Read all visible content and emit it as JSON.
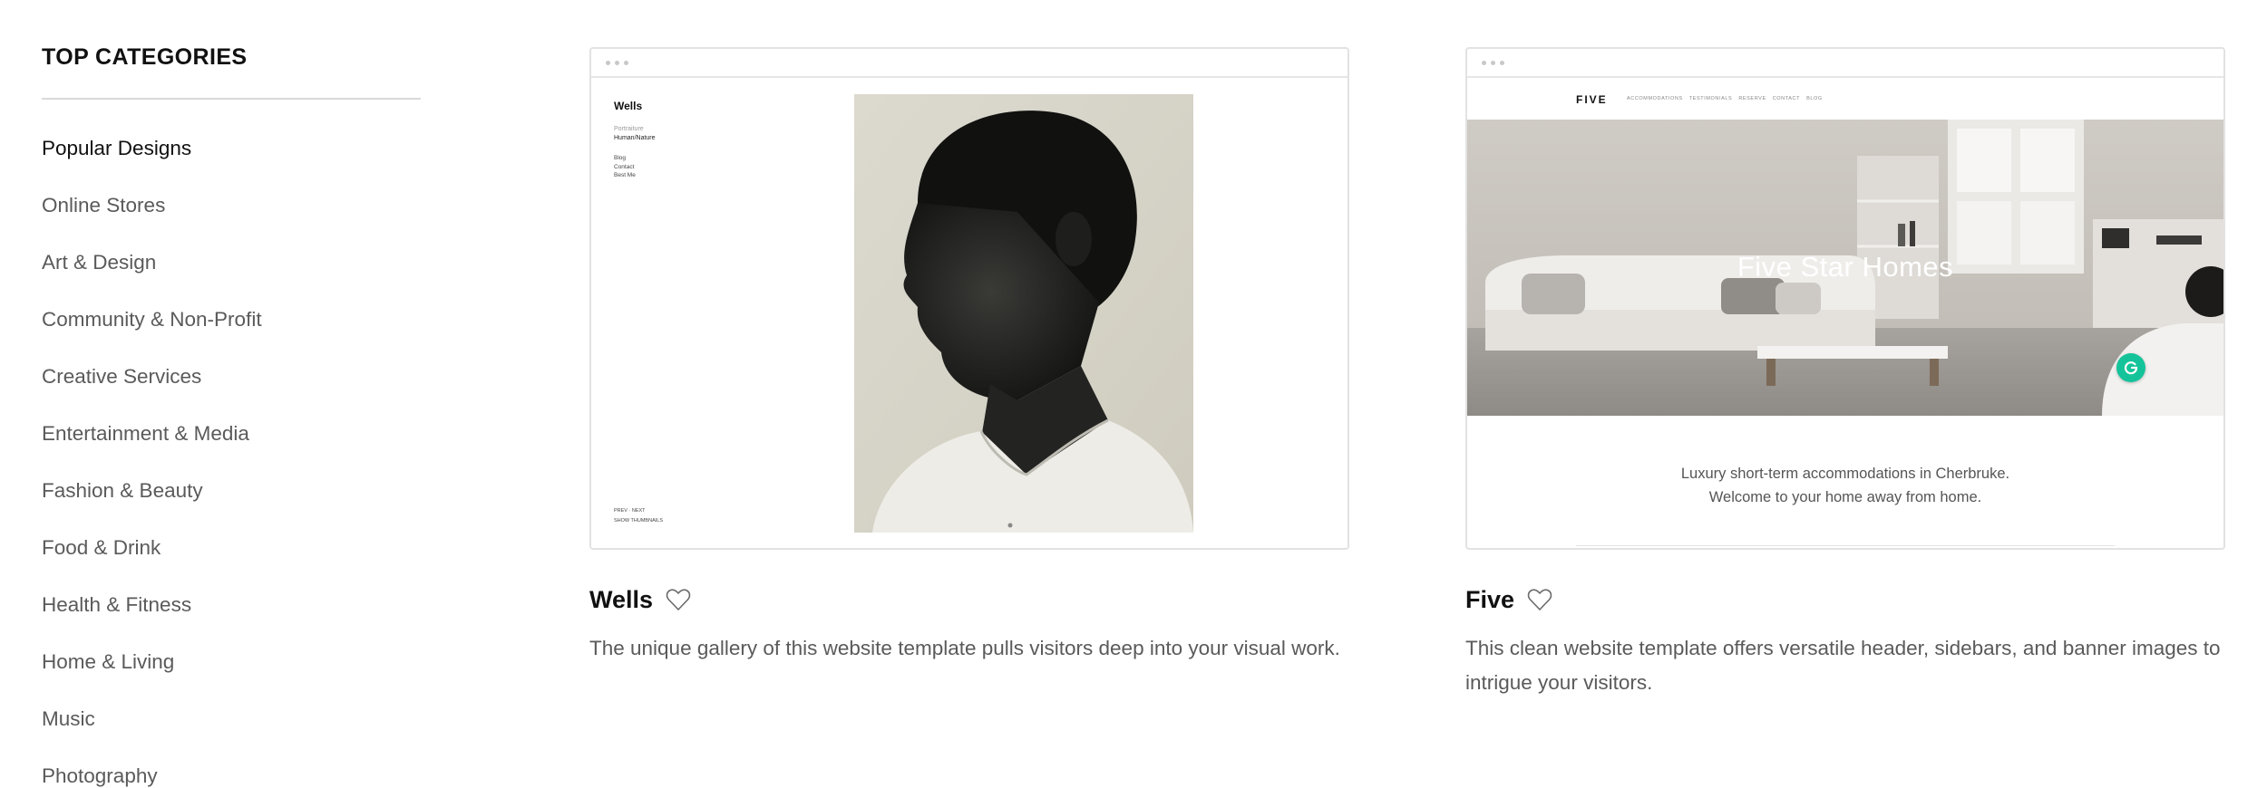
{
  "sidebar": {
    "heading": "TOP CATEGORIES",
    "categories": [
      {
        "label": "Popular Designs",
        "active": true
      },
      {
        "label": "Online Stores"
      },
      {
        "label": "Art & Design"
      },
      {
        "label": "Community & Non-Profit"
      },
      {
        "label": "Creative Services"
      },
      {
        "label": "Entertainment & Media"
      },
      {
        "label": "Fashion & Beauty"
      },
      {
        "label": "Food & Drink"
      },
      {
        "label": "Health & Fitness"
      },
      {
        "label": "Home & Living"
      },
      {
        "label": "Music"
      },
      {
        "label": "Photography"
      }
    ]
  },
  "templates": [
    {
      "name": "Wells",
      "description": "The unique gallery of this website template pulls visitors deep into your visual work.",
      "favorite_icon": "heart-outline-icon",
      "preview": {
        "site_title": "Wells",
        "nav": [
          "Portraiture",
          "Human/Nature"
        ],
        "nav_secondary": [
          "Blog",
          "Contact",
          "Best Me"
        ],
        "footer_nav": "PREV · NEXT",
        "footer_link": "SHOW THUMBNAILS"
      }
    },
    {
      "name": "Five",
      "description": "This clean website template offers versatile header, sidebars, and banner images to intrigue your visitors.",
      "favorite_icon": "heart-outline-icon",
      "preview": {
        "logo": "FIVE",
        "menu": [
          "ACCOMMODATIONS",
          "TESTIMONIALS",
          "RESERVE",
          "CONTACT",
          "BLOG"
        ],
        "hero_title": "Five Star Homes",
        "tagline_line1": "Luxury short-term accommodations in Cherbruke.",
        "tagline_line2": "Welcome to your home away from home."
      }
    }
  ],
  "colors": {
    "text_primary": "#111111",
    "text_secondary": "#5a5a5a",
    "border": "#e2e2e2",
    "grammarly": "#15c39a"
  }
}
